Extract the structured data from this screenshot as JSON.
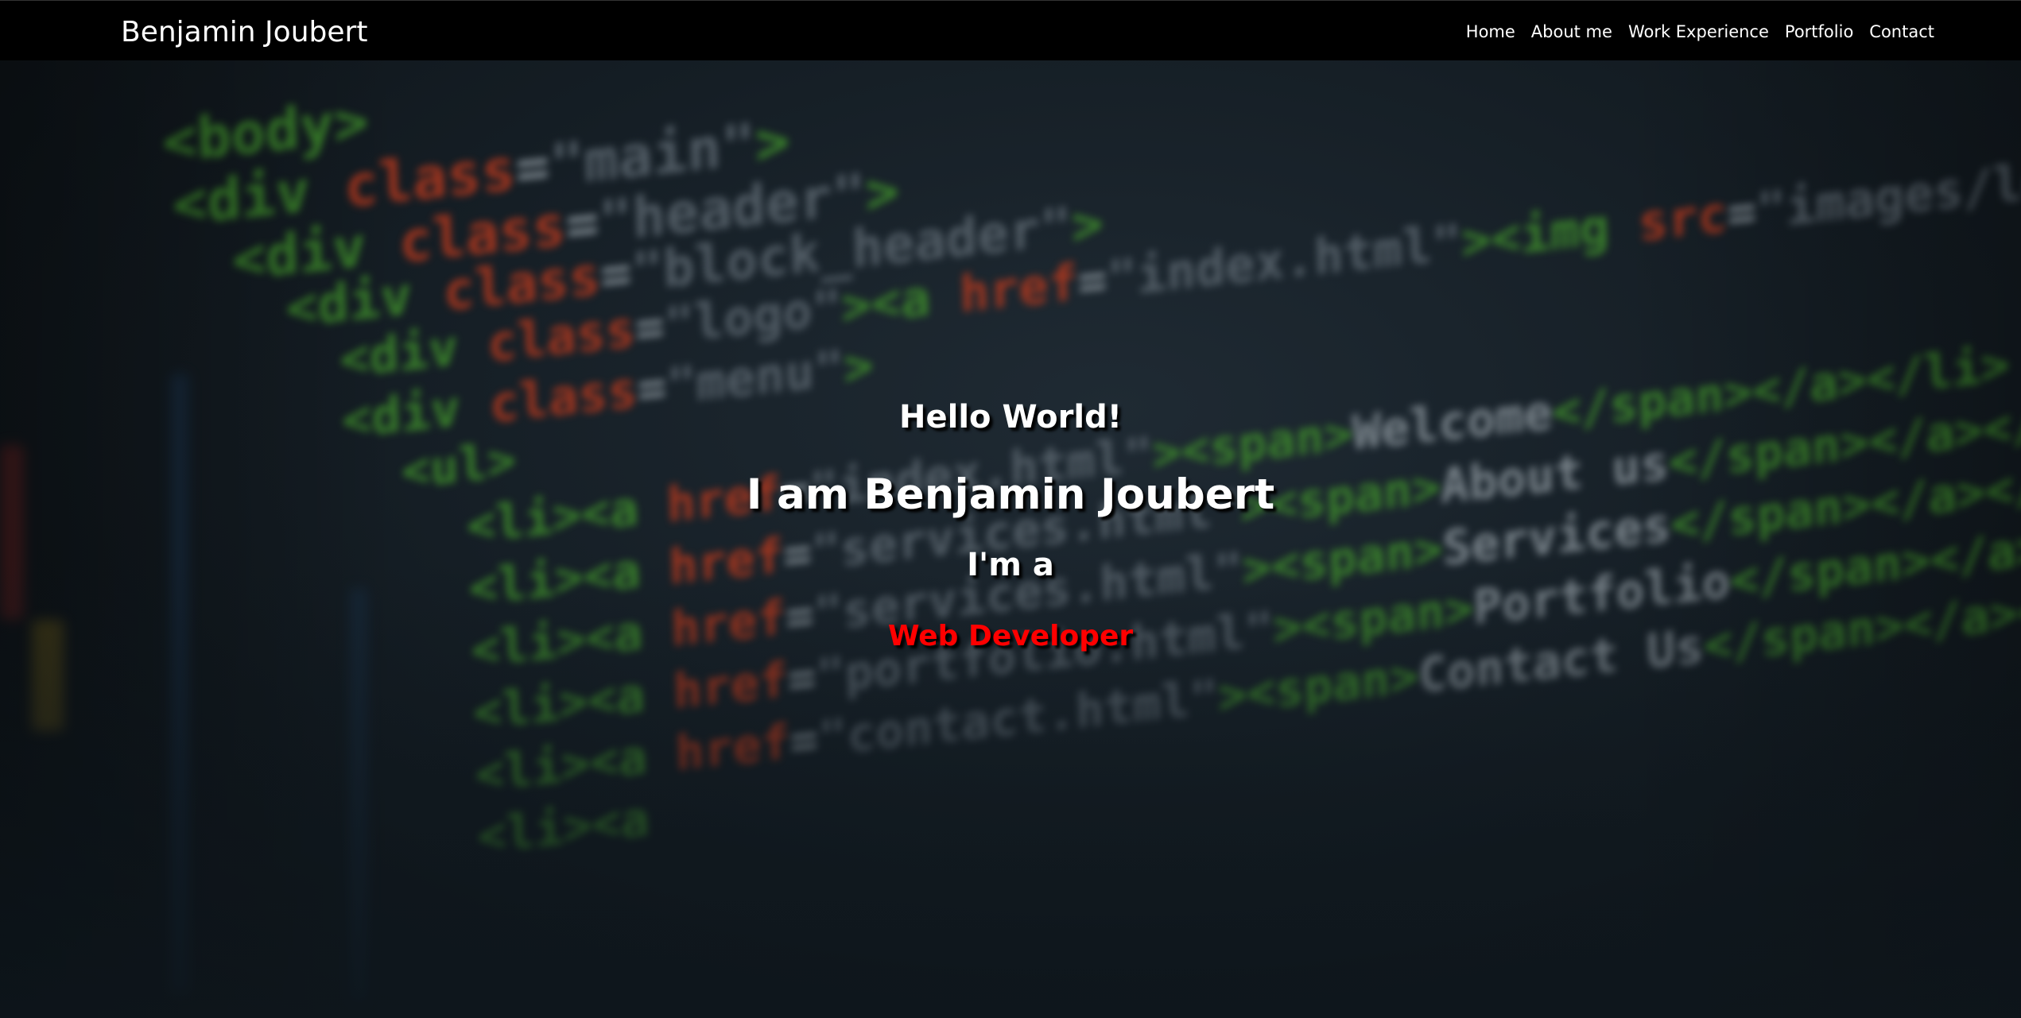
{
  "navbar": {
    "brand": "Benjamin Joubert",
    "links": [
      {
        "label": "Home"
      },
      {
        "label": "About me"
      },
      {
        "label": "Work Experience"
      },
      {
        "label": "Portfolio"
      },
      {
        "label": "Contact"
      }
    ]
  },
  "hero": {
    "greeting": "Hello World!",
    "intro": "I am Benjamin Joubert",
    "prefix": "I'm a",
    "role": "Web Developer",
    "role_color": "#ff0000"
  },
  "background": {
    "description_icon": "blurred-html-code-background",
    "code_lines": [
      "<body>",
      "<div class=\"main\">",
      "  <div class=\"header\">",
      "    <div class=\"block_header\">",
      "      <div class=\"logo\"><a href=\"index.html\"><img src=\"images/logo.gif\"",
      "      <div class=\"menu\">",
      "        <ul>",
      "          <li><a href=\"index.html\"><span>Welcome</span></a></li>",
      "          <li><a href=\"services.html\"><span>About us</span></a></li>",
      "          <li><a href=\"services.html\"><span>Services</span></a></li>",
      "          <li><a href=\"portfolio.html\"><span>Portfolio</span></a></li>",
      "          <li><a href=\"contact.html\"><span>Contact Us</span></a></li>"
    ]
  }
}
